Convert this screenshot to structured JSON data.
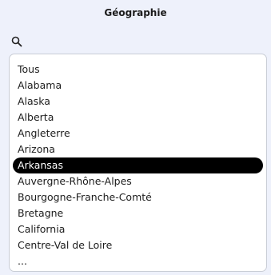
{
  "panel": {
    "title": "Géographie"
  },
  "search": {
    "icon": "search-icon",
    "value": "",
    "placeholder": ""
  },
  "list": {
    "selected_index": 6,
    "items": [
      {
        "label": "Tous"
      },
      {
        "label": "Alabama"
      },
      {
        "label": "Alaska"
      },
      {
        "label": "Alberta"
      },
      {
        "label": "Angleterre"
      },
      {
        "label": "Arizona"
      },
      {
        "label": "Arkansas"
      },
      {
        "label": "Auvergne-Rhône-Alpes"
      },
      {
        "label": "Bourgogne-Franche-Comté"
      },
      {
        "label": "Bretagne"
      },
      {
        "label": "California"
      },
      {
        "label": "Centre-Val de Loire"
      },
      {
        "label": "..."
      }
    ]
  },
  "colors": {
    "page_background": "#eef1fb",
    "list_background": "#ffffff",
    "selected_background": "#000000",
    "selected_text": "#ffffff"
  }
}
